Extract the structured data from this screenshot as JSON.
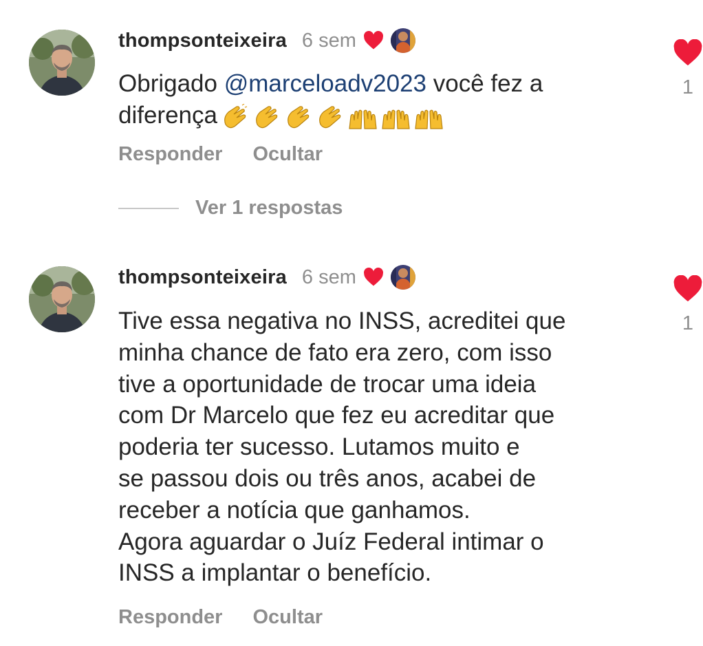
{
  "colors": {
    "heart": "#ed1c3a",
    "text": "#262626",
    "secondary": "#8e8e8e",
    "mention": "#1c3f73"
  },
  "comments": [
    {
      "username": "thompsonteixeira",
      "time": "6 sem",
      "text_before": "Obrigado ",
      "mention": "@marceloadv2023",
      "text_after": " você fez a\ndiferença",
      "emoji": "👏👏👏👏🙌🙌🙌",
      "reply_label": "Responder",
      "hide_label": "Ocultar",
      "like_count": "1",
      "view_replies_label": "Ver 1 respostas"
    },
    {
      "username": "thompsonteixeira",
      "time": "6 sem",
      "text": "Tive essa negativa no INSS, acreditei que\nminha chance de fato era zero, com isso\ntive a oportunidade de trocar uma ideia\ncom Dr Marcelo que fez eu acreditar que\npoderia ter sucesso. Lutamos muito e\nse passou dois ou três anos, acabei de\nreceber a notícia que ganhamos.\nAgora aguardar o Juíz Federal intimar o\nINSS a implantar o benefício.",
      "reply_label": "Responder",
      "hide_label": "Ocultar",
      "like_count": "1"
    }
  ]
}
